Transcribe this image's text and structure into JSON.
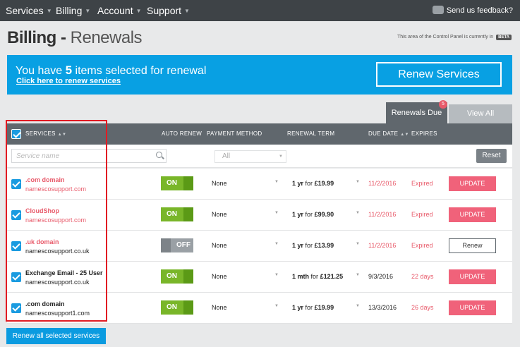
{
  "nav": {
    "items": [
      "Services",
      "Billing",
      "Account",
      "Support"
    ],
    "feedback": "Send us feedback?"
  },
  "page": {
    "title_bold": "Billing -",
    "title_light": "Renewals",
    "beta_note": "This area of the Control Panel is currently in",
    "beta_badge": "BETA"
  },
  "banner": {
    "prefix": "You have",
    "count": "5",
    "suffix": "items selected for renewal",
    "link": "Click here to renew services",
    "button": "Renew Services"
  },
  "tabs": {
    "due": "Renewals Due",
    "due_badge": "5",
    "all": "View All"
  },
  "table": {
    "headers": {
      "services": "SERVICES",
      "auto_renew": "AUTO RENEW",
      "payment_method": "PAYMENT METHOD",
      "renewal_term": "RENEWAL TERM",
      "due_date": "DUE DATE",
      "expires": "EXPIRES"
    },
    "filter": {
      "search_placeholder": "Service name",
      "payment_select": "All",
      "reset": "Reset"
    },
    "rows": [
      {
        "name": ".com domain",
        "host": "namescosupport.com",
        "auto": "ON",
        "payment": "None",
        "term_period": "1 yr",
        "term_for": "for",
        "term_price": "£19.99",
        "due": "11/2/2016",
        "expires": "Expired",
        "action": "UPDATE"
      },
      {
        "name": "CloudShop",
        "host": "namescosupport.com",
        "auto": "ON",
        "payment": "None",
        "term_period": "1 yr",
        "term_for": "for",
        "term_price": "£99.90",
        "due": "11/2/2016",
        "expires": "Expired",
        "action": "UPDATE"
      },
      {
        "name": ".uk domain",
        "host": "namescosupport.co.uk",
        "auto": "OFF",
        "payment": "None",
        "term_period": "1 yr",
        "term_for": "for",
        "term_price": "£13.99",
        "due": "11/2/2016",
        "expires": "Expired",
        "action": "Renew"
      },
      {
        "name": "Exchange Email - 25 User",
        "host": "namescosupport.co.uk",
        "auto": "ON",
        "payment": "None",
        "term_period": "1 mth",
        "term_for": "for",
        "term_price": "£121.25",
        "due": "9/3/2016",
        "expires": "22 days",
        "action": "UPDATE"
      },
      {
        "name": ".com domain",
        "host": "namescosupport1.com",
        "auto": "ON",
        "payment": "None",
        "term_period": "1 yr",
        "term_for": "for",
        "term_price": "£19.99",
        "due": "13/3/2016",
        "expires": "26 days",
        "action": "UPDATE"
      }
    ]
  },
  "footer": {
    "renew_all": "Renew all selected services"
  },
  "colors": {
    "nav_bg": "#3e4347",
    "banner": "#08a0e3",
    "header_bg": "#60676d",
    "toggle_on": "#79b629",
    "update_btn": "#f0627a",
    "expired_text": "#e85a6a",
    "highlight": "#e21b23"
  }
}
